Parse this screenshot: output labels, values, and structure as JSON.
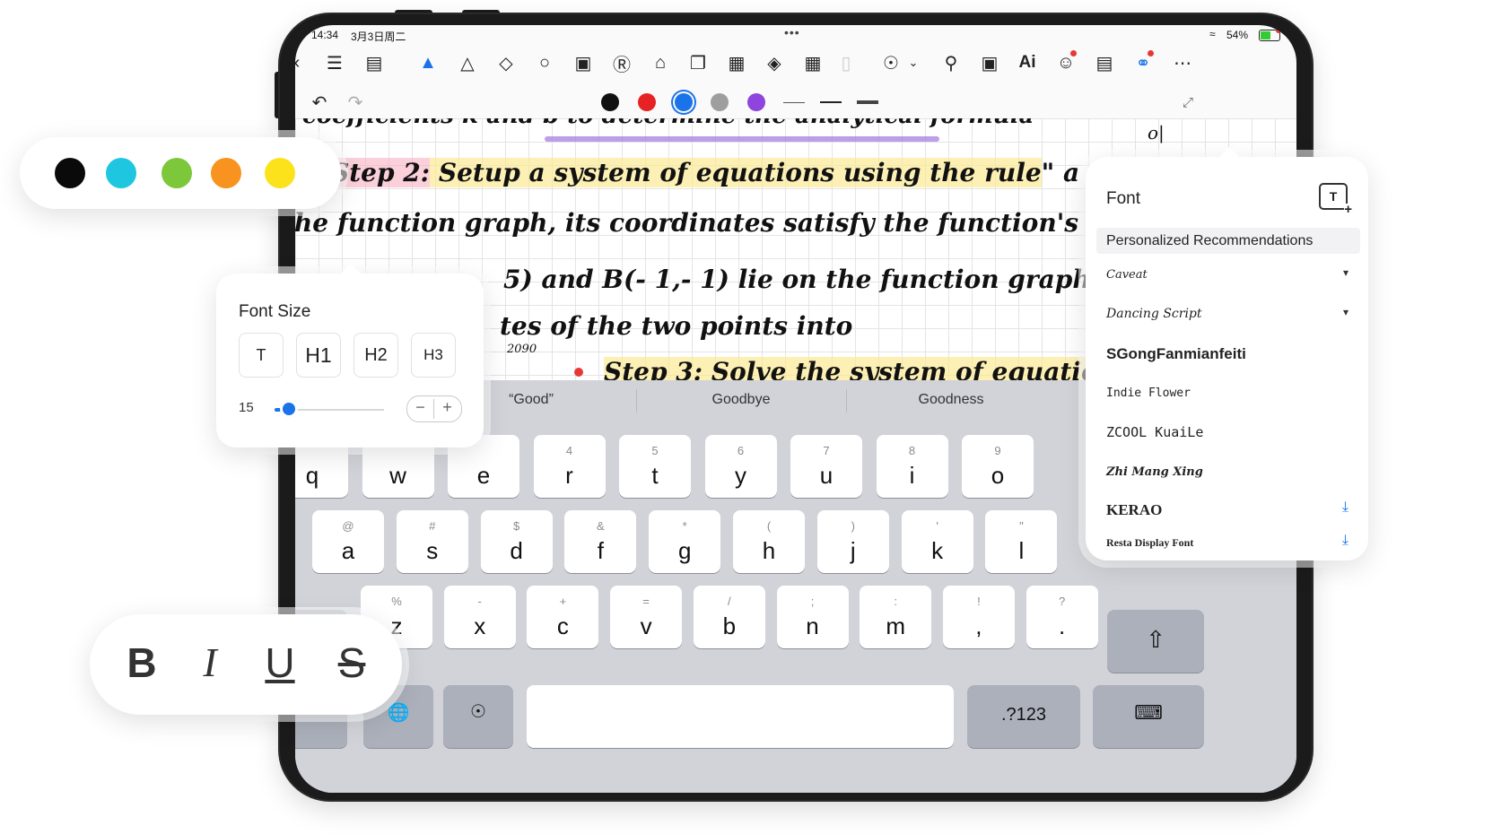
{
  "status_bar": {
    "time": "14:34",
    "date": "3月3日周二",
    "more_dots": "•••",
    "battery_pct": "54%"
  },
  "toolbar_icons": [
    "back-icon",
    "list-icon",
    "outline-icon",
    "pen-icon",
    "highlighter-icon",
    "eraser-icon",
    "lasso-icon",
    "image-icon",
    "text-icon",
    "shape-icon",
    "sticker-icon",
    "textbox-icon",
    "ruler-icon",
    "calculator-icon",
    "divider-icon",
    "microphone-icon",
    "search-icon",
    "screen-icon",
    "ai-icon",
    "emoji-icon",
    "comment-icon",
    "share-icon",
    "more-icon"
  ],
  "ai_label": "Ai",
  "pen_colors": [
    "#111111",
    "#e62222",
    "#1a73e8",
    "#9e9e9e",
    "#8e44dd"
  ],
  "selected_pen_color": "#1a73e8",
  "note": {
    "line1": "coefficients k and b to determine the analytical formula",
    "line2_step": "Step 2:",
    "line2_rest": " Setup a system of equations using the rule",
    "line2_tail": "\" a point l",
    "line3": "the function graph, its coordinates satisfy the function's analytic",
    "line4": "5) and B(- 1,- 1) lie on the function graph,",
    "line5": "tes of the two points into",
    "line6_step": "Step 3:",
    "line6_rest": " Solve the system of equations t",
    "margin_note": "2090",
    "margin_note2": "o|"
  },
  "keyboard": {
    "suggestions": [
      "“Good”",
      "Goodbye",
      "Goodness"
    ],
    "row1": [
      {
        "main": "q",
        "sub": ""
      },
      {
        "main": "w",
        "sub": ""
      },
      {
        "main": "e",
        "sub": ""
      },
      {
        "main": "r",
        "sub": "4"
      },
      {
        "main": "t",
        "sub": "5"
      },
      {
        "main": "y",
        "sub": "6"
      },
      {
        "main": "u",
        "sub": "7"
      },
      {
        "main": "i",
        "sub": "8"
      },
      {
        "main": "o",
        "sub": "9"
      }
    ],
    "row2": [
      {
        "main": "a",
        "sub": "@"
      },
      {
        "main": "s",
        "sub": "#"
      },
      {
        "main": "d",
        "sub": "$"
      },
      {
        "main": "f",
        "sub": "&"
      },
      {
        "main": "g",
        "sub": "*"
      },
      {
        "main": "h",
        "sub": "("
      },
      {
        "main": "j",
        "sub": ")"
      },
      {
        "main": "k",
        "sub": "'"
      },
      {
        "main": "l",
        "sub": "\""
      }
    ],
    "row3": [
      {
        "main": "z",
        "sub": "%"
      },
      {
        "main": "x",
        "sub": "-"
      },
      {
        "main": "c",
        "sub": "+"
      },
      {
        "main": "v",
        "sub": "="
      },
      {
        "main": "b",
        "sub": "/"
      },
      {
        "main": "n",
        "sub": ";"
      },
      {
        "main": "m",
        "sub": ":"
      },
      {
        "main": ",",
        "sub": "!"
      },
      {
        "main": ".",
        "sub": "?"
      }
    ],
    "numbers_key": ".?123"
  },
  "color_palette": [
    "#0a0a0a",
    "#1ec6df",
    "#7cc73a",
    "#f7931e",
    "#fbe21a"
  ],
  "font_size_panel": {
    "title": "Font Size",
    "options": [
      "T",
      "H1",
      "H2",
      "H3"
    ],
    "value": "15",
    "minus": "−",
    "plus": "+"
  },
  "font_panel": {
    "title": "Font",
    "section": "Personalized Recommendations",
    "fonts": [
      {
        "name": "Caveat",
        "action": "chevron"
      },
      {
        "name": "Dancing Script",
        "action": "chevron"
      },
      {
        "name": "SGongFanmianfeiti",
        "action": ""
      },
      {
        "name": "Indie Flower",
        "action": ""
      },
      {
        "name": "ZCOOL KuaiLe",
        "action": ""
      },
      {
        "name": "Zhi Mang Xing",
        "action": ""
      },
      {
        "name": "KERAO",
        "action": "download"
      },
      {
        "name": "Resta Display Font",
        "action": "download"
      }
    ]
  },
  "format_buttons": [
    "B",
    "I",
    "U",
    "S"
  ]
}
